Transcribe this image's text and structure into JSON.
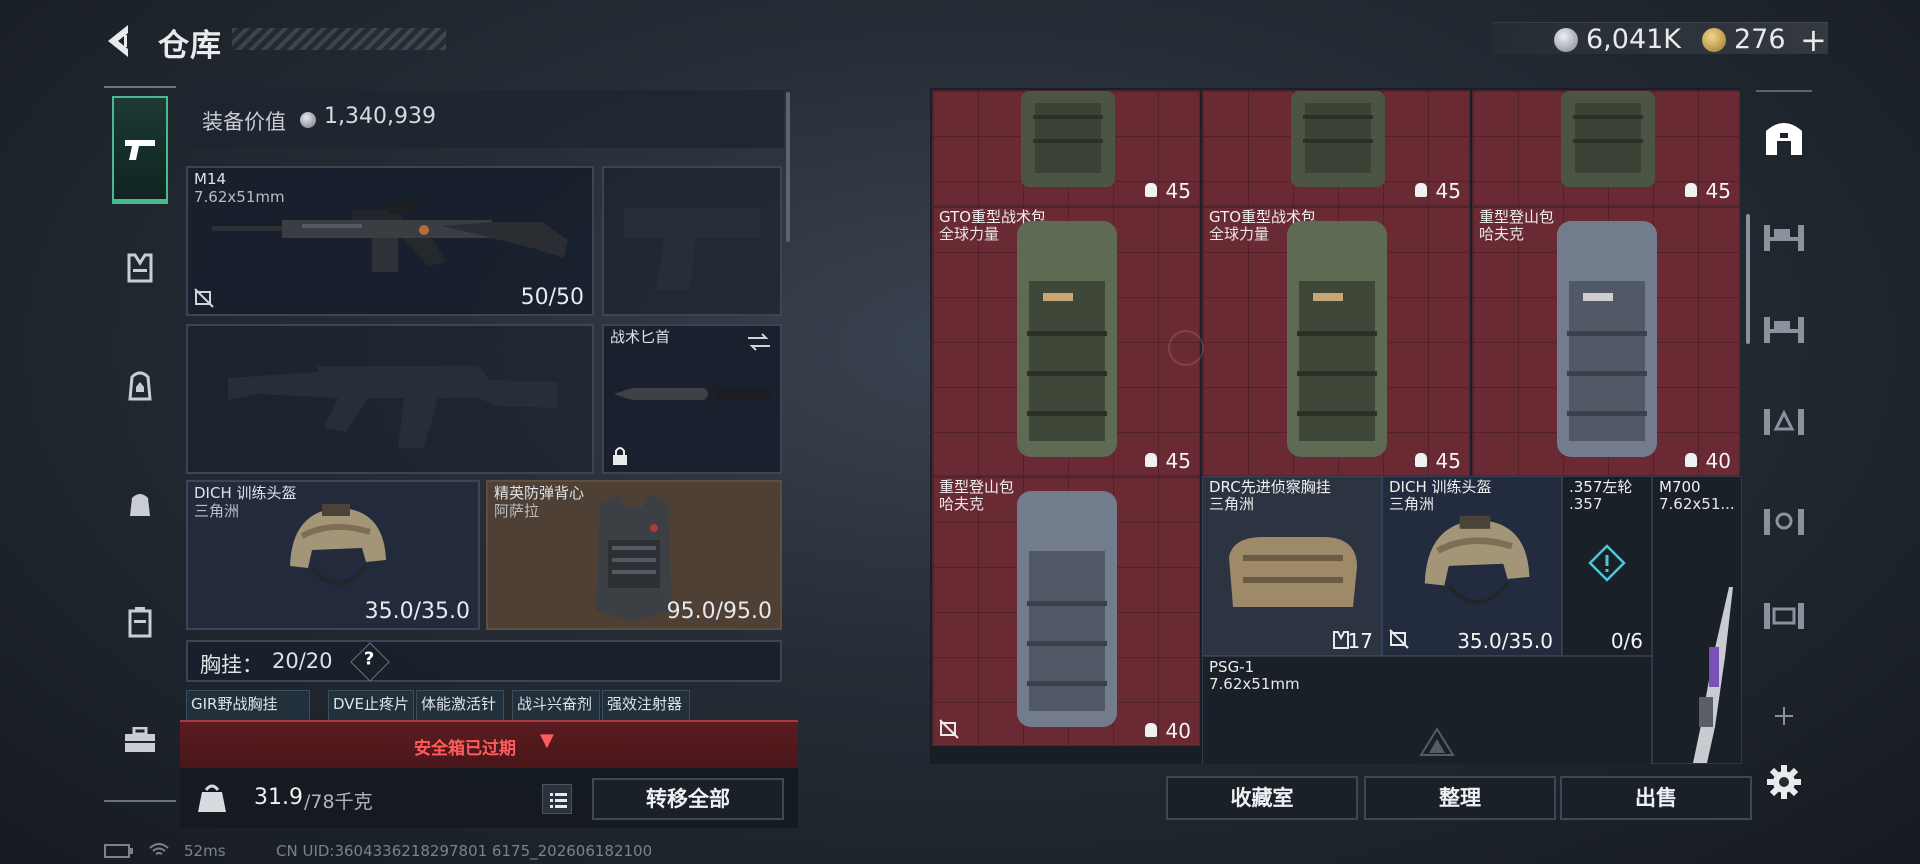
{
  "header": {
    "title": "仓库",
    "silver_amount": "6,041K",
    "gold_amount": "276",
    "add_label": "+"
  },
  "equipment": {
    "value_label": "装备价值",
    "value": "1,340,939",
    "primary": {
      "name": "M14",
      "caliber": "7.62x51mm",
      "ammo": "50/50"
    },
    "melee": {
      "name": "战术匕首"
    },
    "helmet": {
      "name": "DICH 训练头盔",
      "maker": "三角洲",
      "durability": "35.0/35.0"
    },
    "armor": {
      "name": "精英防弹背心",
      "maker": "阿萨拉",
      "durability": "95.0/95.0"
    },
    "chest_rig": {
      "label": "胸挂：",
      "count": "20/20",
      "help": "?"
    },
    "mini_items": [
      "GIR野战胸挂",
      "DVE止疼片",
      "体能激活针",
      "战斗兴奋剂",
      "强效注射器"
    ]
  },
  "safebox": {
    "text": "安全箱已过期",
    "chevron": "▼"
  },
  "bottom": {
    "weight_current": "31.9",
    "weight_max": "/78千克",
    "transfer_all": "转移全部"
  },
  "status": {
    "ping": "52ms",
    "uid": "CN UID:3604336218297801 6175_202606182100"
  },
  "stash": {
    "items": [
      {
        "count": "45"
      },
      {
        "count": "45"
      },
      {
        "count": "45"
      },
      {
        "name": "GTO重型战术包",
        "maker": "全球力量",
        "count": "45"
      },
      {
        "name": "GTO重型战术包",
        "maker": "全球力量",
        "count": "45"
      },
      {
        "name": "重型登山包",
        "maker": "哈夫克",
        "count": "40"
      },
      {
        "name": "重型登山包",
        "maker": "哈夫克",
        "count": "40"
      },
      {
        "name": "DRC先进侦察胸挂",
        "maker": "三角洲",
        "count": "17"
      },
      {
        "name": "DICH 训练头盔",
        "maker": "三角洲",
        "count": "35.0/35.0"
      },
      {
        "name": ".357左轮",
        "maker": ".357",
        "count": "0/6"
      },
      {
        "name": "M700",
        "maker": "7.62x51..."
      },
      {
        "name": "PSG-1",
        "maker": "7.62x51mm"
      }
    ]
  },
  "actions": {
    "collection": "收藏室",
    "sort": "整理",
    "sell": "出售"
  },
  "colors": {
    "accent": "#4ab98e",
    "warning": "#ff5d5d",
    "stash_red": "#6a2a33"
  }
}
